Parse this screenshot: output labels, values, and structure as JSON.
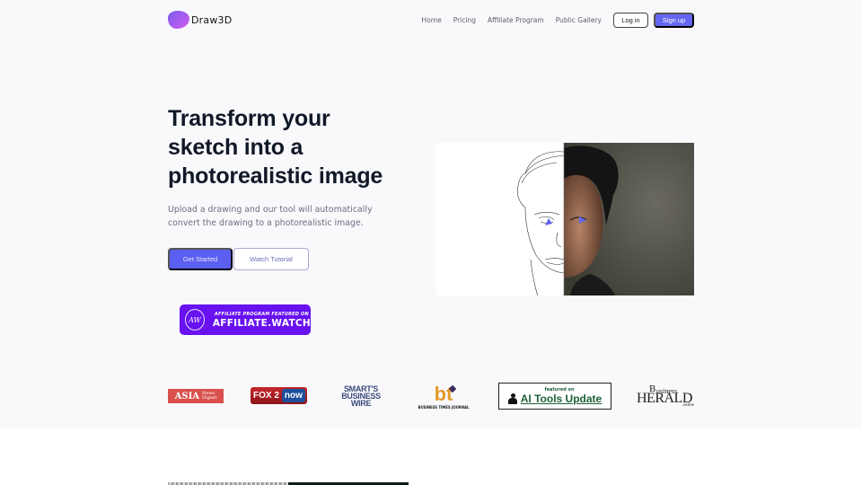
{
  "header": {
    "brand": "Draw3D",
    "nav_links": [
      "Home",
      "Pricing",
      "Affiliate Program",
      "Public Gallery"
    ],
    "login_label": "Log in",
    "signup_label": "Sign up"
  },
  "hero": {
    "title": "Transform your sketch into a photorealistic image",
    "subtitle": "Upload a drawing and our tool will automatically convert the drawing to a photorealistic image.",
    "primary_cta": "Get Started",
    "secondary_cta": "Watch Tutorial",
    "image_alt": "Sketch to photo face comparison"
  },
  "affiliate_badge": {
    "monogram": "AW",
    "top_line": "AFFILIATE PROGRAM FEATURED ON",
    "main_line": "AFFILIATE.WATCH"
  },
  "press_logos": {
    "asia": {
      "main": "ASIA",
      "small_1": "News",
      "small_2": "Digest"
    },
    "fox": {
      "main": "FOX 2",
      "now": "now"
    },
    "smart": {
      "line1": "SMART'S",
      "line2": "BUSINESS",
      "line3": "WIRE"
    },
    "btj": {
      "mark": "bt",
      "caption": "BUSINESS TIMES JOURNAL"
    },
    "aitools": {
      "featured": "featured on",
      "main": "AI Tools Update"
    },
    "herald": {
      "b_big": "B",
      "b_rest": "usiness",
      "main": "HERALD",
      "online": "online"
    }
  },
  "colors": {
    "accent": "#6366f1",
    "badge": "#6812f0",
    "hero_bg": "#f9f9fc"
  }
}
